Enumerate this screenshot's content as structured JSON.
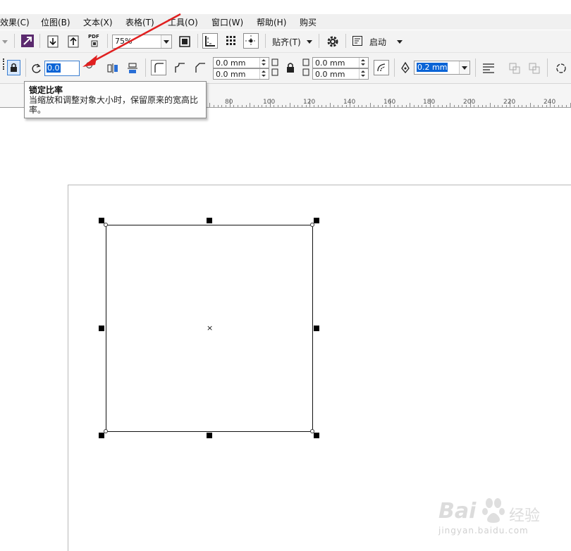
{
  "menu": [
    {
      "label": "效果(C)",
      "underline": "C"
    },
    {
      "label": "位图(B)",
      "underline": "B"
    },
    {
      "label": "文本(X)",
      "underline": "X"
    },
    {
      "label": "表格(T)",
      "underline": "T"
    },
    {
      "label": "工具(O)",
      "underline": "O"
    },
    {
      "label": "窗口(W)",
      "underline": "W"
    },
    {
      "label": "帮助(H)",
      "underline": "H"
    },
    {
      "label": "购买"
    }
  ],
  "toolbar": {
    "zoom": "75%",
    "pdf_label": "PDF",
    "snap_label": "贴齐(T)",
    "launch_label": "启动"
  },
  "property_bar": {
    "rotation_value": "0.0",
    "corner_radius": [
      "0.0 mm",
      "0.0 mm",
      "0.0 mm",
      "0.0 mm"
    ],
    "outline_width": "0.2 mm"
  },
  "ruler": {
    "labels": [
      "80",
      "100",
      "120",
      "140",
      "160",
      "180",
      "200",
      "220",
      "240"
    ]
  },
  "tooltip": {
    "title": "锁定比率",
    "body": "当缩放和调整对象大小时，保留原来的宽高比率。"
  },
  "watermark": {
    "brand": "Bai",
    "brand_cn": "经验",
    "url": "jingyan.baidu.com"
  },
  "colors": {
    "accent_arrow": "#e02020",
    "selection_highlight": "#0a64d6",
    "toolbar_bg": "#f3f3f3"
  }
}
